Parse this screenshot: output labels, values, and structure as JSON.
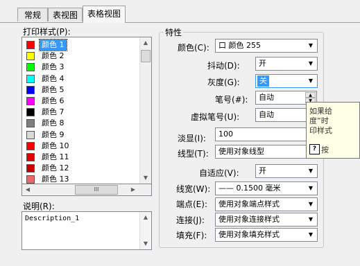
{
  "tabs": [
    "常规",
    "表视图",
    "表格视图"
  ],
  "left": {
    "print_style_label": "打印样式(P):",
    "colors": [
      {
        "name": "颜色 1",
        "swatch": "#ff0000"
      },
      {
        "name": "颜色 2",
        "swatch": "#ffff00"
      },
      {
        "name": "颜色 3",
        "swatch": "#00ff00"
      },
      {
        "name": "颜色 4",
        "swatch": "#00ffff"
      },
      {
        "name": "颜色 5",
        "swatch": "#0000ff"
      },
      {
        "name": "颜色 6",
        "swatch": "#ff00ff"
      },
      {
        "name": "颜色 7",
        "swatch": "#000000"
      },
      {
        "name": "颜色 8",
        "swatch": "#808080"
      },
      {
        "name": "颜色 9",
        "swatch": "#d9d9d9"
      },
      {
        "name": "颜色 10",
        "swatch": "#ff0000"
      },
      {
        "name": "颜色 11",
        "swatch": "#e00000"
      },
      {
        "name": "颜色 12",
        "swatch": "#cc0000"
      },
      {
        "name": "颜色 13",
        "swatch": "#ee6666"
      }
    ],
    "hscroll_glyph": "III",
    "desc_label": "说明(R):",
    "desc_value": "Description_1"
  },
  "props": {
    "group_title": "特性",
    "color_label": "颜色(C):",
    "color_value": "口 颜色 255",
    "dither_label": "抖动(D):",
    "dither_value": "开",
    "gray_label": "灰度(G):",
    "gray_value": "关",
    "pen_label": "笔号(#):",
    "pen_value": "自动",
    "vpen_label": "虚拟笔号(U):",
    "vpen_value": "自动",
    "screen_label": "淡显(I):",
    "screen_value": "100",
    "linetype_label": "线型(T):",
    "linetype_value": "使用对象线型",
    "adaptive_label": "自适应(V):",
    "adaptive_value": "开",
    "lineweight_label": "线宽(W):",
    "lineweight_value": "—— 0.1500 毫米",
    "endcap_label": "端点(E):",
    "endcap_value": "使用对象端点样式",
    "join_label": "连接(J):",
    "join_value": "使用对象连接样式",
    "fill_label": "填充(F):",
    "fill_value": "使用对象填充样式"
  },
  "tooltip": {
    "line1": "如果给",
    "line2": "度”时",
    "line3": "印样式",
    "help_text": "按"
  }
}
